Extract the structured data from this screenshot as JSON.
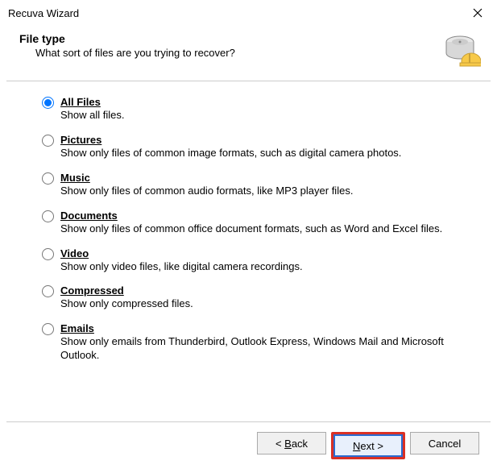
{
  "window": {
    "title": "Recuva Wizard"
  },
  "header": {
    "title": "File type",
    "subtitle": "What sort of files are you trying to recover?"
  },
  "options": {
    "all": {
      "label": "All Files",
      "desc": "Show all files."
    },
    "pictures": {
      "label": "Pictures",
      "desc": "Show only files of common image formats, such as digital camera photos."
    },
    "music": {
      "label": "Music",
      "desc": "Show only files of common audio formats, like MP3 player files."
    },
    "documents": {
      "label": "Documents",
      "desc": "Show only files of common office document formats, such as Word and Excel files."
    },
    "video": {
      "label": "Video",
      "desc": "Show only video files, like digital camera recordings."
    },
    "compressed": {
      "label": "Compressed",
      "desc": "Show only compressed files."
    },
    "emails": {
      "label": "Emails",
      "desc": "Show only emails from Thunderbird, Outlook Express, Windows Mail and Microsoft Outlook."
    }
  },
  "buttons": {
    "back": "< Back",
    "next": "Next >",
    "cancel": "Cancel"
  }
}
